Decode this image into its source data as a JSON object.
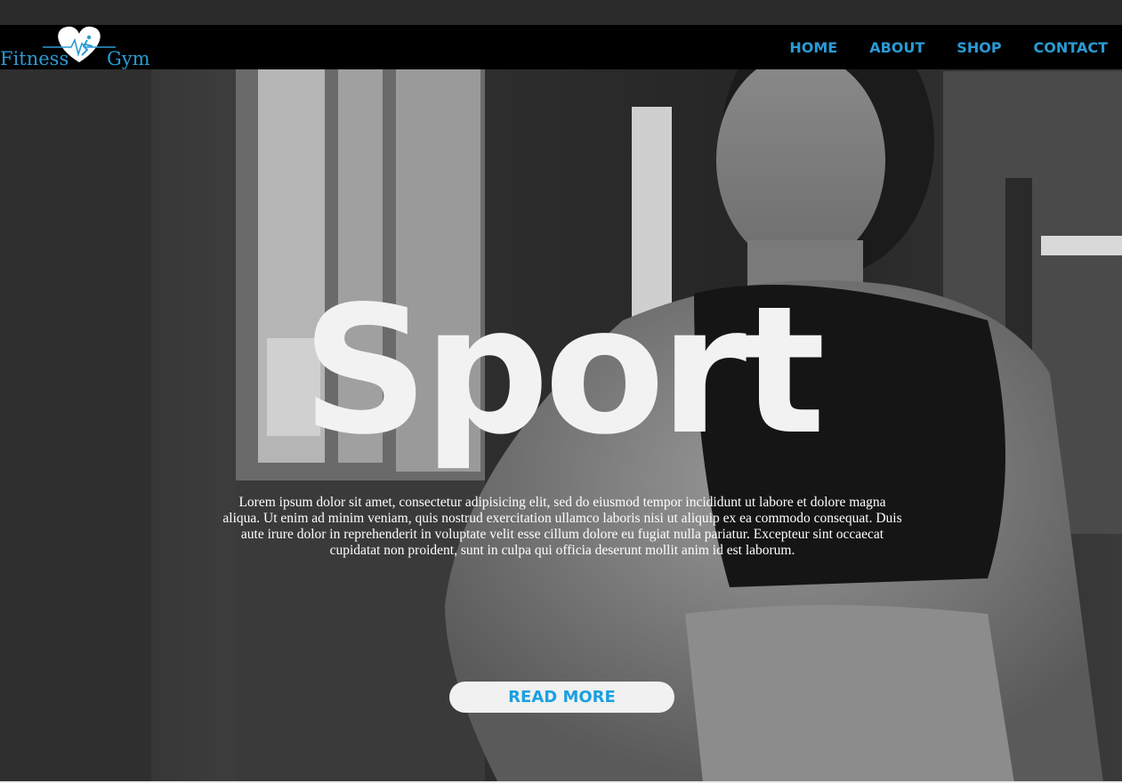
{
  "brand": {
    "name_left": "Fitness",
    "name_right": "Gym",
    "logo_icon": "heart-runner-icon",
    "color": "#2a9bd6"
  },
  "nav": {
    "items": [
      {
        "label": "HOME"
      },
      {
        "label": "ABOUT"
      },
      {
        "label": "SHOP"
      },
      {
        "label": "CONTACT"
      }
    ],
    "color": "#2a9bd6"
  },
  "hero": {
    "headline": "Sport",
    "body": "Lorem ipsum dolor sit amet, consectetur adipisicing elit, sed do eiusmod tempor incididunt ut labore et dolore magna aliqua. Ut enim ad minim veniam, quis nostrud exercitation ullamco laboris nisi ut aliquip ex ea commodo consequat. Duis aute irure dolor in reprehenderit in voluptate velit esse cillum dolore eu fugiat nulla pariatur. Excepteur sint occaecat cupidatat non proident, sunt in culpa qui officia deserunt mollit anim id est laborum.",
    "cta_label": "READ MORE",
    "cta_color": "#1aa0e0",
    "background": "grayscale-photo-woman-in-gym"
  }
}
